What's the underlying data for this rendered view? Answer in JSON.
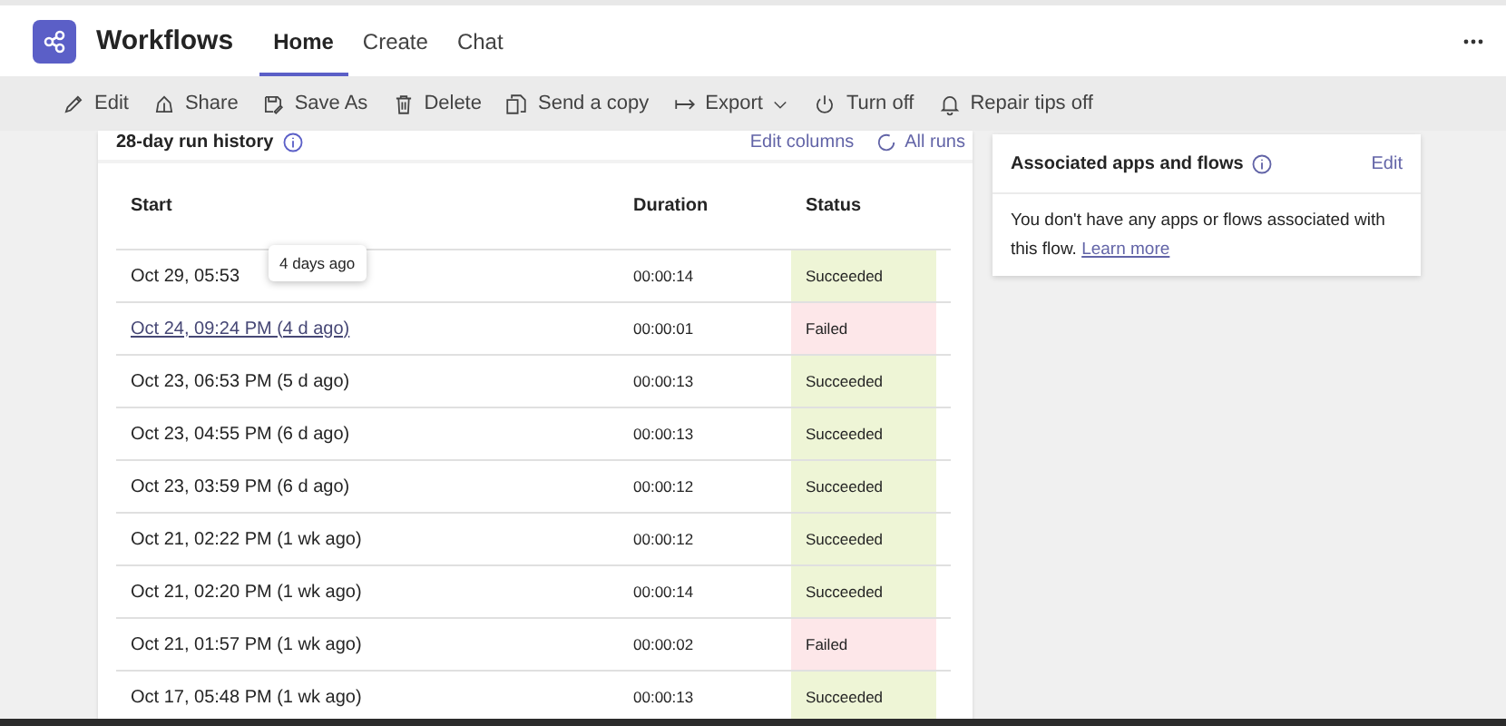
{
  "app": {
    "title": "Workflows"
  },
  "tabs": [
    {
      "label": "Home",
      "selected": true
    },
    {
      "label": "Create",
      "selected": false
    },
    {
      "label": "Chat",
      "selected": false
    }
  ],
  "toolbar": [
    {
      "label": "Edit",
      "dropdown": false
    },
    {
      "label": "Share",
      "dropdown": false
    },
    {
      "label": "Save As",
      "dropdown": false
    },
    {
      "label": "Delete",
      "dropdown": false
    },
    {
      "label": "Send a copy",
      "dropdown": false
    },
    {
      "label": "Export",
      "dropdown": true
    },
    {
      "label": "Turn off",
      "dropdown": false
    },
    {
      "label": "Repair tips off",
      "dropdown": false
    }
  ],
  "run_history": {
    "title": "28-day run history",
    "edit_columns": "Edit columns",
    "all_runs": "All runs",
    "columns": [
      "Start",
      "Duration",
      "Status"
    ],
    "rows": [
      {
        "start": "Oct 29, 05:53",
        "duration": "00:00:14",
        "status": "Succeeded",
        "kind": "success",
        "hovered": false,
        "tooltip": "4 days ago"
      },
      {
        "start": "Oct 24, 09:24 PM (4 d ago)",
        "duration": "00:00:01",
        "status": "Failed",
        "kind": "failure",
        "hovered": true
      },
      {
        "start": "Oct 23, 06:53 PM (5 d ago)",
        "duration": "00:00:13",
        "status": "Succeeded",
        "kind": "success",
        "hovered": false
      },
      {
        "start": "Oct 23, 04:55 PM (6 d ago)",
        "duration": "00:00:13",
        "status": "Succeeded",
        "kind": "success",
        "hovered": false
      },
      {
        "start": "Oct 23, 03:59 PM (6 d ago)",
        "duration": "00:00:12",
        "status": "Succeeded",
        "kind": "success",
        "hovered": false
      },
      {
        "start": "Oct 21, 02:22 PM (1 wk ago)",
        "duration": "00:00:12",
        "status": "Succeeded",
        "kind": "success",
        "hovered": false
      },
      {
        "start": "Oct 21, 02:20 PM (1 wk ago)",
        "duration": "00:00:14",
        "status": "Succeeded",
        "kind": "success",
        "hovered": false
      },
      {
        "start": "Oct 21, 01:57 PM (1 wk ago)",
        "duration": "00:00:02",
        "status": "Failed",
        "kind": "failure",
        "hovered": false
      },
      {
        "start": "Oct 17, 05:48 PM (1 wk ago)",
        "duration": "00:00:13",
        "status": "Succeeded",
        "kind": "success",
        "hovered": false
      }
    ]
  },
  "associated": {
    "title": "Associated apps and flows",
    "edit": "Edit",
    "message": "You don't have any apps or flows associated with this flow.",
    "link": "Learn more"
  }
}
